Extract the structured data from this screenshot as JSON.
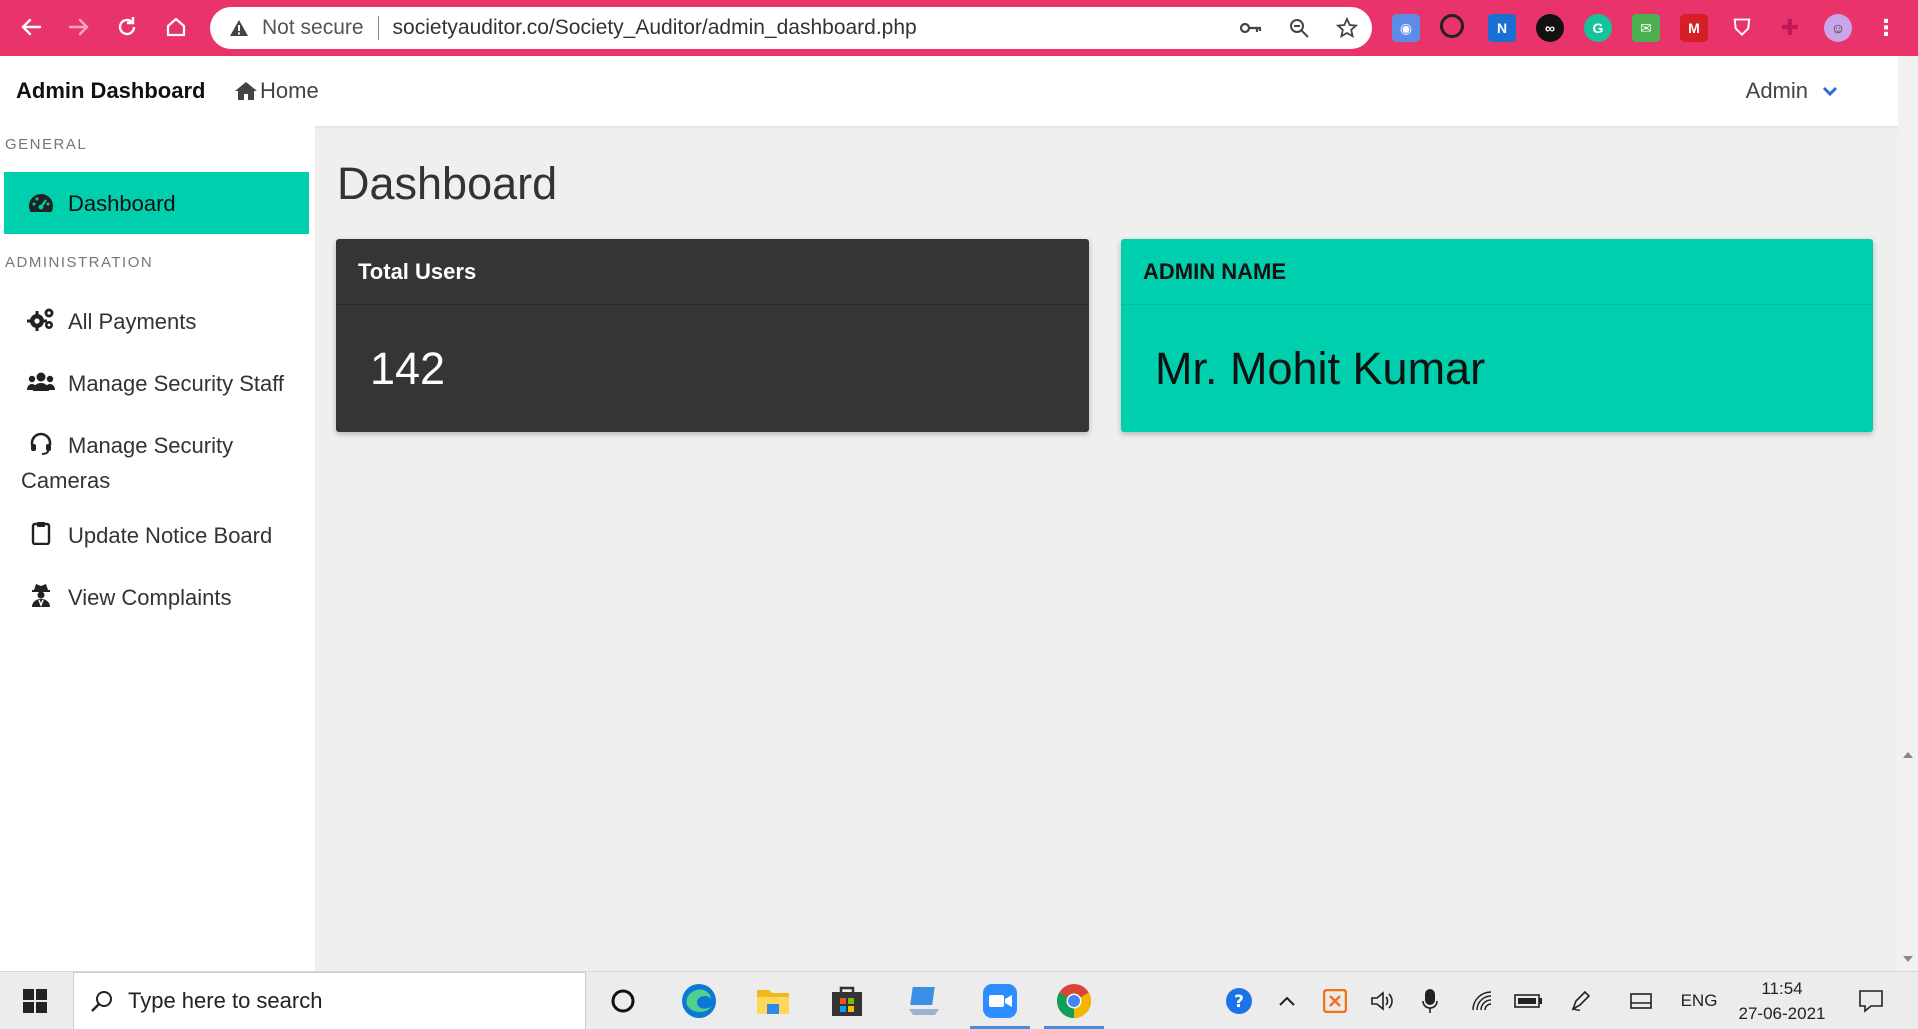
{
  "browser": {
    "security_label": "Not secure",
    "url": "societyauditor.co/Society_Auditor/admin_dashboard.php"
  },
  "topbar": {
    "brand": "Admin Dashboard",
    "home_label": "Home",
    "user_menu_label": "Admin"
  },
  "sidebar": {
    "sections": [
      {
        "label": "GENERAL"
      },
      {
        "label": "ADMINISTRATION"
      }
    ],
    "items": [
      {
        "label": "Dashboard",
        "icon": "tachometer-icon",
        "active": true
      },
      {
        "label": "All Payments",
        "icon": "cogs-icon"
      },
      {
        "label": "Manage Security Staff",
        "icon": "users-icon"
      },
      {
        "label": "Manage Security",
        "label_line2": "Cameras",
        "icon": "headset-icon"
      },
      {
        "label": "Update Notice Board",
        "icon": "clipboard-icon"
      },
      {
        "label": "View Complaints",
        "icon": "user-secret-icon"
      }
    ]
  },
  "main": {
    "title": "Dashboard",
    "cards": [
      {
        "header": "Total Users",
        "value": "142"
      },
      {
        "header": "ADMIN NAME",
        "value": "Mr. Mohit Kumar"
      }
    ]
  },
  "taskbar": {
    "search_placeholder": "Type here to search",
    "language": "ENG",
    "time": "11:54",
    "date": "27-06-2021"
  },
  "colors": {
    "browser_chrome": "#e8336b",
    "accent_teal": "#00cfae",
    "card_dark": "#353535",
    "content_bg": "#efefef"
  }
}
